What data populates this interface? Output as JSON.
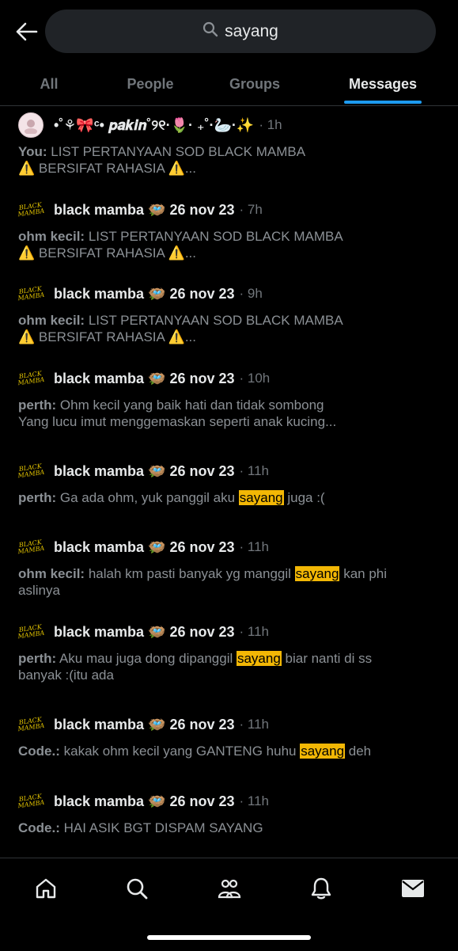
{
  "search": {
    "query": "sayang"
  },
  "tabs": [
    {
      "label": "All"
    },
    {
      "label": "People"
    },
    {
      "label": "Groups"
    },
    {
      "label": "Messages"
    }
  ],
  "results": [
    {
      "name": "•˚⚘🎀ᶜ• 𝒑𝒂𝒌𝒊𝒏˚୨୧·🌷· ₊˚·🦢·✨",
      "time": "· 1h",
      "sender": "You:",
      "line1": "LIST PERTANYAAN SOD BLACK MAMBA",
      "line2": "⚠️ BERSIFAT RAHASIA ⚠️..."
    },
    {
      "name": "black mamba 🪺 26 nov 23",
      "time": "· 7h",
      "sender": "ohm kecil:",
      "line1": "LIST PERTANYAAN SOD BLACK MAMBA",
      "line2": "⚠️ BERSIFAT RAHASIA ⚠️..."
    },
    {
      "name": "black mamba 🪺 26 nov 23",
      "time": "· 9h",
      "sender": "ohm kecil:",
      "line1": "LIST PERTANYAAN SOD BLACK MAMBA",
      "line2": "⚠️ BERSIFAT RAHASIA ⚠️..."
    },
    {
      "name": "black mamba 🪺 26 nov 23",
      "time": "· 10h",
      "sender": "perth:",
      "line1": "Ohm kecil yang baik hati dan tidak sombong",
      "line2": "Yang lucu imut menggemaskan seperti anak kucing..."
    },
    {
      "name": "black mamba 🪺 26 nov 23",
      "time": "· 11h",
      "sender": "perth:",
      "pre": "Ga ada ohm, yuk panggil aku ",
      "hl": "sayang",
      "post": " juga :("
    },
    {
      "name": "black mamba 🪺 26 nov 23",
      "time": "· 11h",
      "sender": "ohm kecil:",
      "pre": "halah km pasti banyak yg manggil ",
      "hl": "sayang",
      "post": " kan phi",
      "line2": "aslinya"
    },
    {
      "name": "black mamba 🪺 26 nov 23",
      "time": "· 11h",
      "sender": "perth:",
      "pre": "Aku mau juga dong dipanggil ",
      "hl": "sayang",
      "post": " biar nanti di ss",
      "line2": "banyak :(itu ada"
    },
    {
      "name": "black mamba 🪺 26 nov 23",
      "time": "· 11h",
      "sender": "Code.:",
      "pre": "kakak ohm kecil yang GANTENG huhu ",
      "hl": "sayang",
      "post": " deh"
    },
    {
      "name": "black mamba 🪺 26 nov 23",
      "time": "· 11h",
      "sender": "Code.:",
      "line1": "HAI ASIK BGT DISPAM SAYANG"
    }
  ],
  "avatar_text": "BLACK MAMBA",
  "colors": {
    "accent": "#1d9bf0",
    "highlight": "#f2b705",
    "background": "#000000"
  },
  "bottom_nav": [
    {
      "icon": "home-icon"
    },
    {
      "icon": "search-icon"
    },
    {
      "icon": "communities-icon"
    },
    {
      "icon": "notifications-icon"
    },
    {
      "icon": "messages-icon"
    }
  ]
}
